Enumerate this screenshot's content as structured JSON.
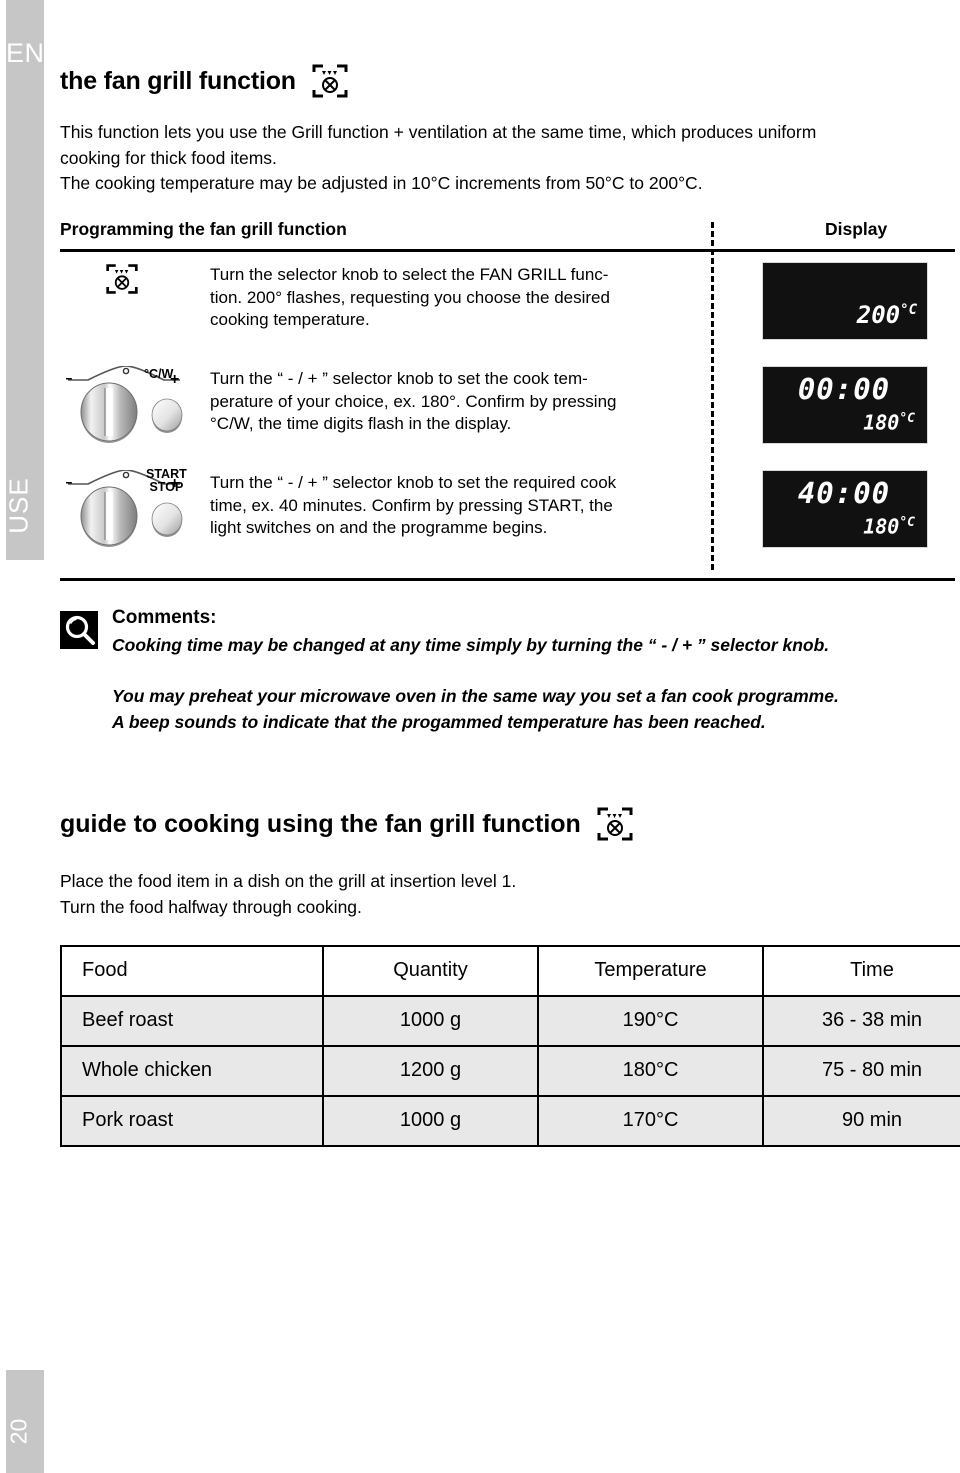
{
  "rail": {
    "language": "EN",
    "section": "USE",
    "page_number": "20",
    "gray": "#c6c6c6"
  },
  "heading": {
    "title": "the fan grill function",
    "icon": "fan-grill-icon"
  },
  "intro": {
    "line1": "This function lets you use the Grill function + ventilation at the same time, which produces uniform",
    "line2": "cooking for thick food items.",
    "line3": "The cooking temperature may be adjusted in 10°C increments from 50°C to 200°C."
  },
  "programming": {
    "header_left": "Programming the fan grill function",
    "header_right": "Display",
    "steps": [
      {
        "control": "fan-grill-icon",
        "text": {
          "line1": "Turn the selector knob to select the FAN GRILL func-",
          "line2": "tion. 200° flashes, requesting you choose the desired",
          "line3": "cooking temperature."
        },
        "display": {
          "time": "",
          "temp": "200",
          "temp_unit": "°C"
        }
      },
      {
        "control": "minus-plus-knob",
        "button_label_line1": "°C/W",
        "button_label_line2": "",
        "text": {
          "line1": "Turn the “  - / +  ” selector knob to set the cook tem-",
          "line2": "perature of your choice, ex. 180°. Confirm by pressing",
          "line3": "°C/W, the time digits flash in the display."
        },
        "display": {
          "time": "00:00",
          "temp": "180",
          "temp_unit": "°C"
        }
      },
      {
        "control": "minus-plus-knob",
        "button_label_line1": "START",
        "button_label_line2": "STOP",
        "text": {
          "line1": "Turn the “ - / + ” selector knob to set the required cook",
          "line2": "time, ex. 40 minutes. Confirm by pressing START, the",
          "line3": "light switches on and the programme begins."
        },
        "display": {
          "time": "40:00",
          "temp": "180",
          "temp_unit": "°C"
        }
      }
    ],
    "knob_minus": "–",
    "knob_plus": "+"
  },
  "comments": {
    "icon": "magnifier-icon",
    "title": "Comments:",
    "line1": "Cooking time may be changed at any time simply by turning the “ - / + ” selector knob.",
    "line2": "You may preheat your microwave oven in the same way you set a fan cook programme.",
    "line3": "A beep sounds to indicate that the progammed temperature has been reached."
  },
  "guide": {
    "title": "guide to cooking using the fan grill function",
    "icon": "fan-grill-icon",
    "note_line1": "Place the food item in a dish on the grill at insertion level 1.",
    "note_line2": "Turn the food halfway through cooking."
  },
  "food_table": {
    "columns": [
      "Food",
      "Quantity",
      "Temperature",
      "Time"
    ],
    "rows": [
      {
        "food": "Beef roast",
        "quantity": "1000 g",
        "temperature": "190°C",
        "time": "36 - 38 min"
      },
      {
        "food": "Whole chicken",
        "quantity": "1200 g",
        "temperature": "180°C",
        "time": "75 - 80 min"
      },
      {
        "food": "Pork roast",
        "quantity": "1000 g",
        "temperature": "170°C",
        "time": "90 min"
      }
    ]
  }
}
